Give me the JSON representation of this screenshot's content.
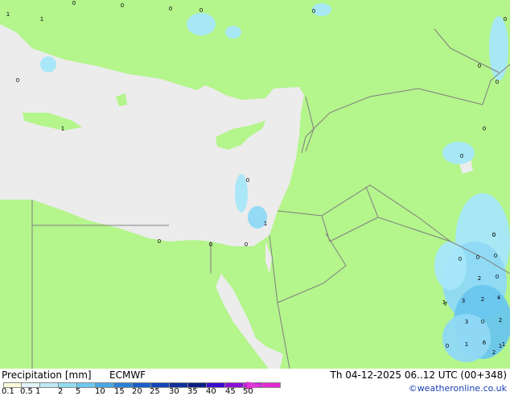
{
  "map": {
    "land_color": "#b4f58c",
    "sea_color": "#ececec",
    "border_color": "#7f7f7f",
    "precip_colors": [
      "#a6e7fa",
      "#8fd9f5",
      "#6ac6ee"
    ],
    "values": [
      "0",
      "0",
      "0",
      "0",
      "0",
      "0",
      "1",
      "1",
      "0",
      "0",
      "0",
      "1",
      "0",
      "0",
      "1",
      "0",
      "0",
      "0",
      "0",
      "0",
      "0",
      "0",
      "0",
      "0",
      "2",
      "0",
      "1",
      "3",
      "2",
      "4",
      "7",
      "3",
      "0",
      "2",
      "0",
      "1",
      "6",
      "1",
      "2",
      "1"
    ]
  },
  "footer": {
    "title": "Precipitation [mm]",
    "model": "ECMWF",
    "valid_time": "Th 04-12-2025 06..12 UTC (00+348)",
    "credit": "©weatheronline.co.uk",
    "scale_colors": [
      "#fffadc",
      "#e0f4fa",
      "#bde9f8",
      "#94dcf3",
      "#6cc9ed",
      "#4aa7e3",
      "#2a82d6",
      "#1a5ec8",
      "#1646b6",
      "#10309c",
      "#0a1f82",
      "#3a0ad0",
      "#8a0fd8",
      "#c21ad8",
      "#e32ad6"
    ],
    "scale_labels": [
      "0.1",
      "0.5",
      "1",
      "2",
      "5",
      "10",
      "15",
      "20",
      "25",
      "30",
      "35",
      "40",
      "45",
      "50"
    ]
  }
}
